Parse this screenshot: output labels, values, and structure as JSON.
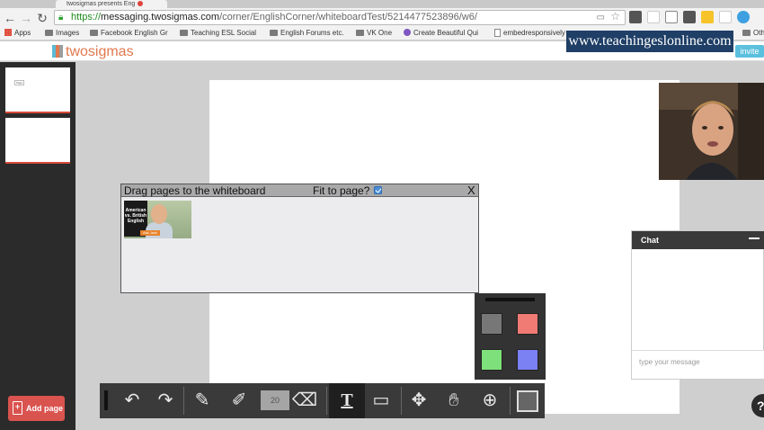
{
  "browser": {
    "tab_title": "twosigmas presents Eng",
    "url_scheme": "https://",
    "url_host": "messaging.twosigmas.com",
    "url_path": "/corner/EnglishCorner/whiteboardTest/5214477523896/w6/",
    "bookmarks": [
      {
        "label": "Apps",
        "icon": "apps-icon"
      },
      {
        "label": "Images",
        "icon": "folder-icon"
      },
      {
        "label": "Facebook English Gr",
        "icon": "folder-icon"
      },
      {
        "label": "Teaching ESL Social",
        "icon": "folder-icon"
      },
      {
        "label": "English Forums etc.",
        "icon": "folder-icon"
      },
      {
        "label": "VK One",
        "icon": "folder-icon"
      },
      {
        "label": "Create Beautiful Qui",
        "icon": "quiz-icon"
      },
      {
        "label": "embedresponsively",
        "icon": "doc-icon"
      },
      {
        "label": "Oth",
        "icon": "folder-icon"
      }
    ]
  },
  "watermark": "www.teachingeslonline.com",
  "app": {
    "logo_text": "twosigmas",
    "invite_label": "invite"
  },
  "sidebar": {
    "thumb_text": "Page",
    "add_page_label": "Add page"
  },
  "drag_dialog": {
    "title": "Drag pages to the whiteboard",
    "fit_label": "Fit to page?",
    "close_label": "X",
    "thumb_text": "American vs. British English",
    "thumb_badge": "Ask Jack"
  },
  "colors": {
    "swatches": [
      "#777777",
      "#f07a74",
      "#7ee07a",
      "#7b80f2"
    ]
  },
  "chat": {
    "title": "Chat",
    "placeholder": "type your message",
    "help_label": "?"
  },
  "toolbar": {
    "brush_size": "20",
    "tools": [
      "undo",
      "redo",
      "pencil",
      "marker",
      "size",
      "eraser",
      "text",
      "open-folder",
      "move",
      "pan-hand",
      "zoom",
      "square"
    ]
  }
}
